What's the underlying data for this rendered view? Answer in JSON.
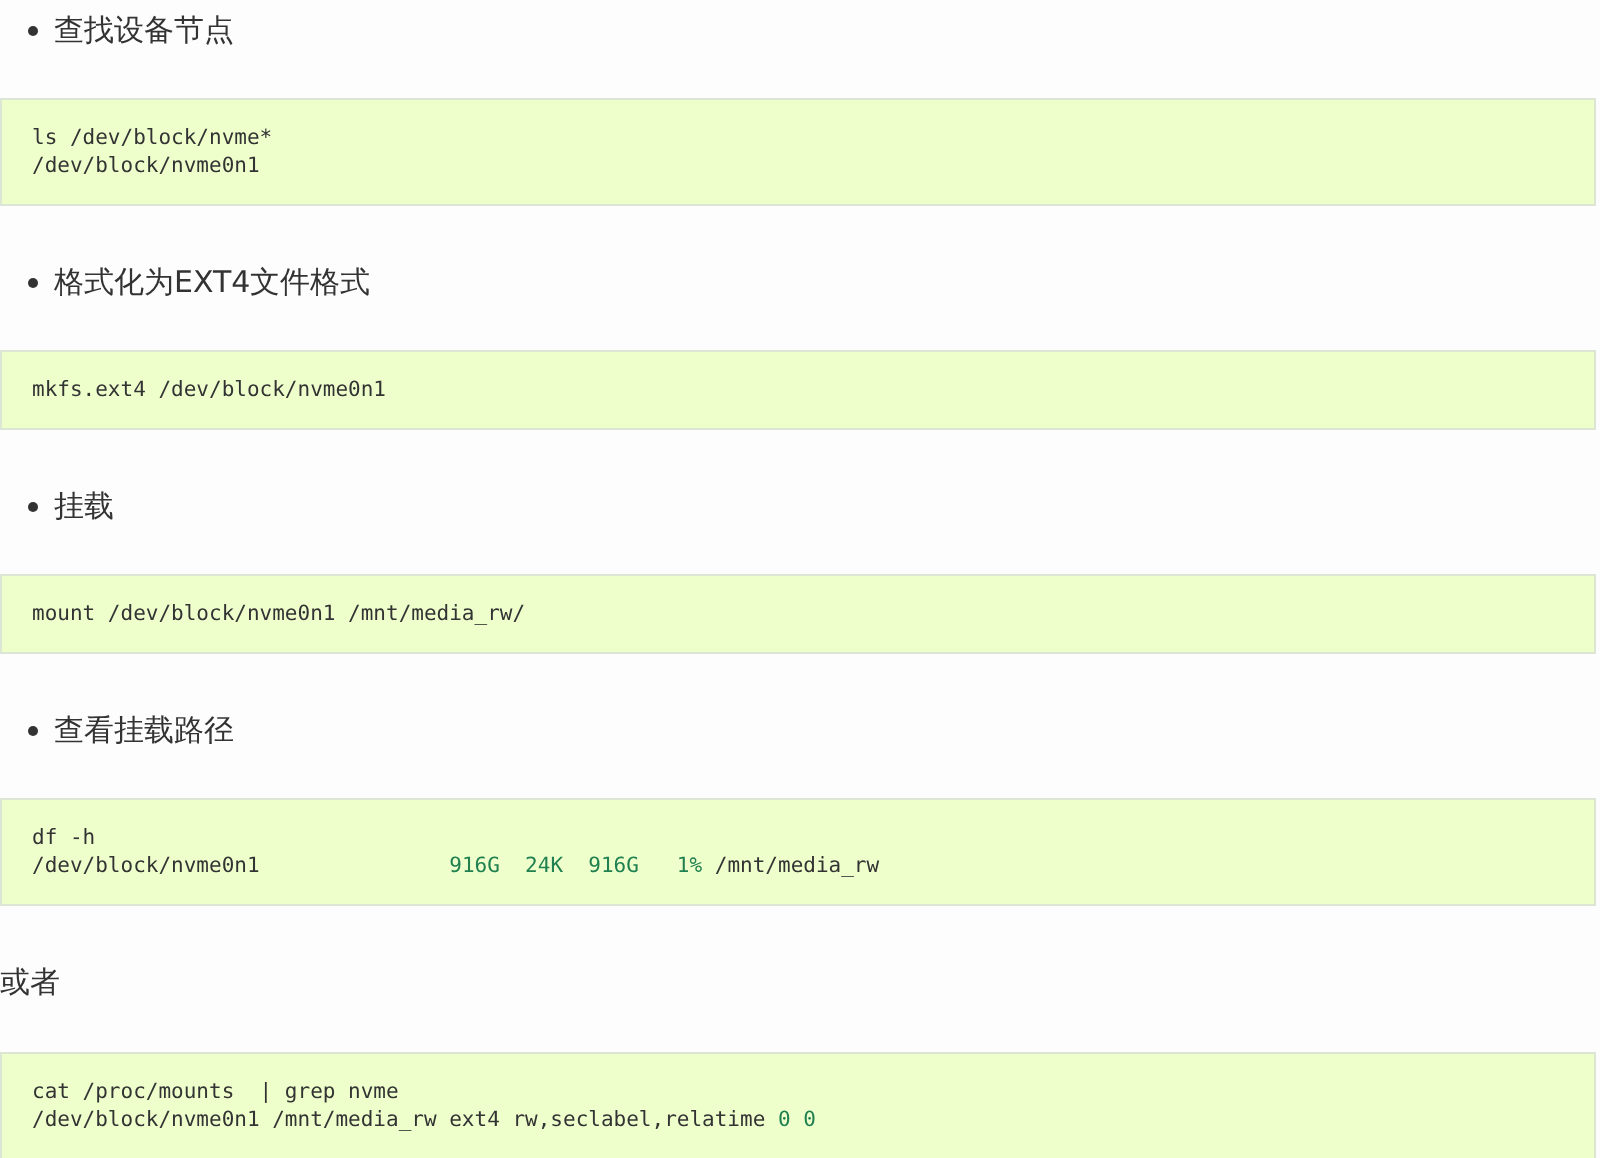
{
  "sections": [
    {
      "kind": "bullet",
      "text": "查找设备节点"
    },
    {
      "kind": "code",
      "lines": [
        {
          "segments": [
            {
              "kind": "plain",
              "text": "ls /dev/block/nvme*"
            }
          ]
        },
        {
          "segments": [
            {
              "kind": "plain",
              "text": "/dev/block/nvme0n1"
            }
          ]
        }
      ]
    },
    {
      "kind": "bullet",
      "text": "格式化为EXT4文件格式"
    },
    {
      "kind": "code",
      "lines": [
        {
          "segments": [
            {
              "kind": "plain",
              "text": "mkfs.ext4 /dev/block/nvme0n1"
            }
          ]
        }
      ]
    },
    {
      "kind": "bullet",
      "text": "挂载"
    },
    {
      "kind": "code",
      "lines": [
        {
          "segments": [
            {
              "kind": "plain",
              "text": "mount /dev/block/nvme0n1 /mnt/media_rw/"
            }
          ]
        }
      ]
    },
    {
      "kind": "bullet",
      "text": "查看挂载路径"
    },
    {
      "kind": "code",
      "lines": [
        {
          "segments": [
            {
              "kind": "plain",
              "text": "df -h"
            }
          ]
        },
        {
          "segments": [
            {
              "kind": "plain",
              "text": "/dev/block/nvme0n1               "
            },
            {
              "kind": "number",
              "text": "916G  24K  916G   1%"
            },
            {
              "kind": "plain",
              "text": " /mnt/media_rw"
            }
          ]
        }
      ]
    },
    {
      "kind": "paragraph",
      "text": "或者"
    },
    {
      "kind": "code",
      "lines": [
        {
          "segments": [
            {
              "kind": "plain",
              "text": "cat /proc/mounts  | grep nvme"
            }
          ]
        },
        {
          "segments": [
            {
              "kind": "plain",
              "text": "/dev/block/nvme0n1 /mnt/media_rw ext4 rw,seclabel,relatime "
            },
            {
              "kind": "number",
              "text": "0 0"
            }
          ]
        }
      ]
    }
  ]
}
